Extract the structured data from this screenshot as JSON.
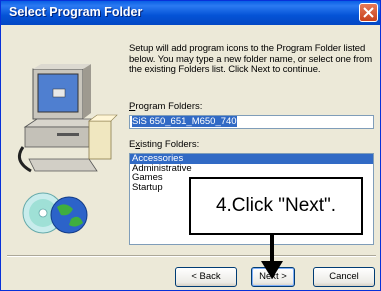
{
  "window": {
    "title": "Select Program Folder"
  },
  "instructions": "Setup will add program icons to the Program Folder listed below. You may type a new folder name, or select one from the existing Folders list.  Click Next to continue.",
  "program_folders": {
    "label_prefix": "",
    "label_accel": "P",
    "label_rest": "rogram Folders:",
    "value": "SiS 650_651_M650_740"
  },
  "existing_folders": {
    "label_prefix": "E",
    "label_accel": "x",
    "label_rest": "isting Folders:",
    "items": [
      "Accessories",
      "Administrative",
      "Games",
      "Startup"
    ],
    "selected_index": 0
  },
  "buttons": {
    "back": "< Back",
    "back_accel": "B",
    "next": "Next >",
    "next_accel": "N",
    "cancel": "Cancel"
  },
  "callout": {
    "text": "4.Click \"Next\"."
  },
  "colors": {
    "titlebar": "#0453d6",
    "selection": "#316ac5",
    "dialog_bg": "#ece9d8"
  }
}
